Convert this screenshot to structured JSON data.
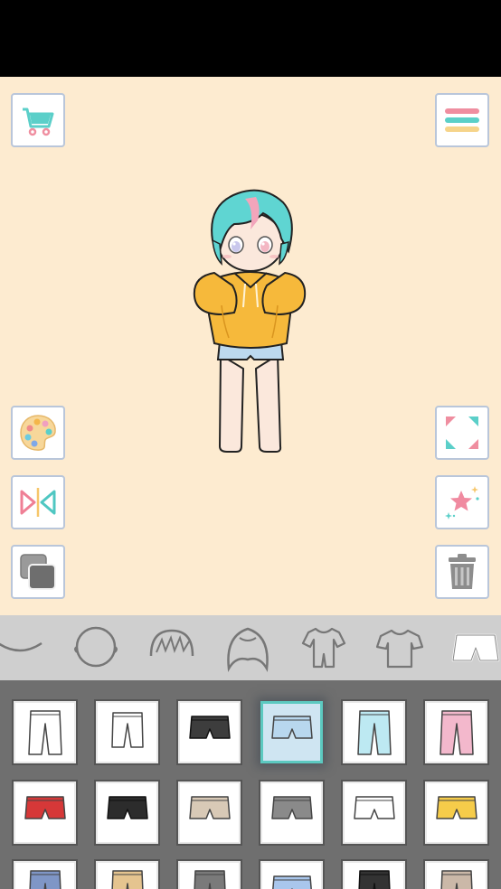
{
  "app": {
    "toolbar_left": [
      {
        "name": "shop-cart-icon"
      },
      {
        "name": "color-palette-icon"
      },
      {
        "name": "flip-icon"
      },
      {
        "name": "layer-icon"
      }
    ],
    "toolbar_right": [
      {
        "name": "menu-icon",
        "colors": [
          "#ef8ea0",
          "#5bd0c8",
          "#f6d48a"
        ]
      },
      {
        "name": "fullscreen-icon"
      },
      {
        "name": "favorite-star-icon"
      },
      {
        "name": "trash-icon"
      }
    ]
  },
  "categories": [
    {
      "name": "mouth-icon"
    },
    {
      "name": "face-icon"
    },
    {
      "name": "bangs-icon"
    },
    {
      "name": "back-hair-icon"
    },
    {
      "name": "onesie-icon"
    },
    {
      "name": "shirt-icon"
    },
    {
      "name": "shorts-icon",
      "active": true
    }
  ],
  "items": [
    {
      "name": "white-long-pants",
      "color": "#ffffff"
    },
    {
      "name": "white-cropped-pants",
      "color": "#ffffff"
    },
    {
      "name": "black-shorts",
      "color": "#3d3d3d"
    },
    {
      "name": "denim-shorts",
      "color": "#b8d7ee",
      "selected": true
    },
    {
      "name": "light-blue-pants",
      "color": "#bde9f2"
    },
    {
      "name": "pink-polka-pants",
      "color": "#f3b8cc"
    },
    {
      "name": "red-sport-shorts",
      "color": "#d63838"
    },
    {
      "name": "black-sport-shorts",
      "color": "#2c2c2c"
    },
    {
      "name": "beige-cargo-shorts",
      "color": "#d8c9b6"
    },
    {
      "name": "grey-cargo-shorts",
      "color": "#8a8a8a"
    },
    {
      "name": "white-shorts",
      "color": "#ffffff"
    },
    {
      "name": "yellow-shorts",
      "color": "#f6cc4a"
    },
    {
      "name": "blue-pants",
      "color": "#7f96c6"
    },
    {
      "name": "khaki-pants",
      "color": "#e5c48f"
    },
    {
      "name": "grey-pants",
      "color": "#7a7a7a"
    },
    {
      "name": "light-blue-shorts",
      "color": "#a9c6ec"
    },
    {
      "name": "black-pants",
      "color": "#333333"
    },
    {
      "name": "tan-pants",
      "color": "#cbb8a8"
    }
  ]
}
